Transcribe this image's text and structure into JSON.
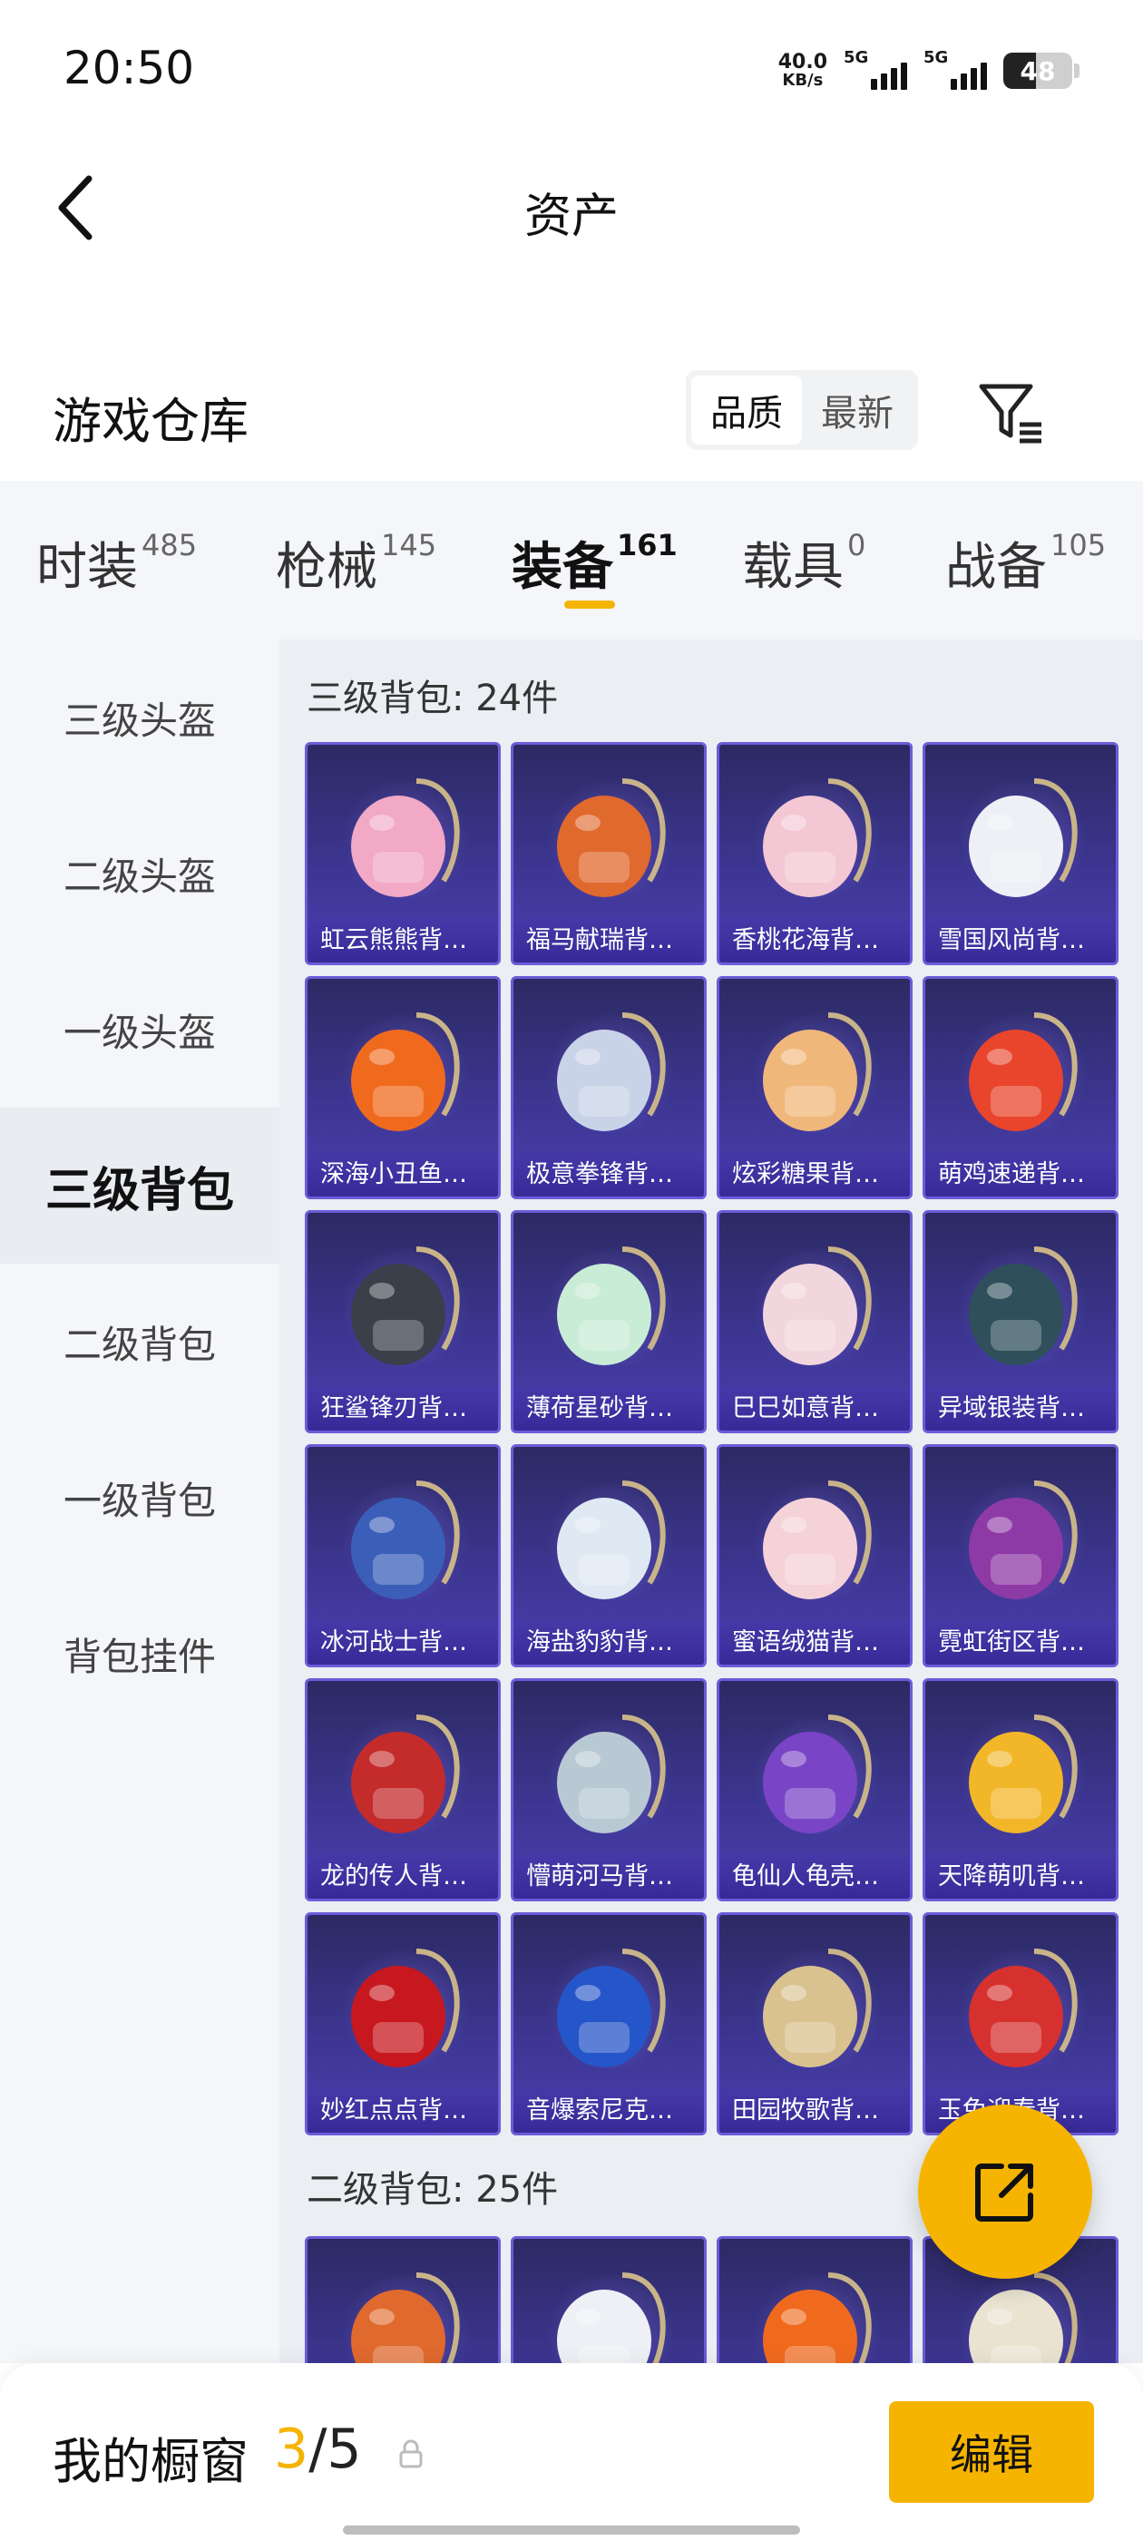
{
  "status_bar": {
    "time": "20:50",
    "net_speed_value": "40.0",
    "net_speed_unit": "KB/s",
    "sim1_tag": "5G",
    "sim2_tag": "5G",
    "battery": "48"
  },
  "header": {
    "back_icon": "chevron-left-icon",
    "title": "资产"
  },
  "section": {
    "title": "游戏仓库",
    "sort_options": [
      "品质",
      "最新"
    ],
    "active_sort": "品质",
    "filter_icon": "filter-icon"
  },
  "category_tabs": [
    {
      "label": "时装",
      "count": "485"
    },
    {
      "label": "枪械",
      "count": "145"
    },
    {
      "label": "装备",
      "count": "161",
      "active": true
    },
    {
      "label": "载具",
      "count": "0"
    },
    {
      "label": "战备",
      "count": "105"
    }
  ],
  "sidebar": [
    {
      "label": "三级头盔"
    },
    {
      "label": "二级头盔"
    },
    {
      "label": "一级头盔"
    },
    {
      "label": "三级背包",
      "active": true
    },
    {
      "label": "二级背包"
    },
    {
      "label": "一级背包"
    },
    {
      "label": "背包挂件"
    }
  ],
  "groups": [
    {
      "title": "三级背包: 24件",
      "items": [
        {
          "name": "虹云熊熊背…",
          "color": "#f1a9c6"
        },
        {
          "name": "福马献瑞背…",
          "color": "#e0692d"
        },
        {
          "name": "香桃花海背…",
          "color": "#f3c7d4"
        },
        {
          "name": "雪国风尚背…",
          "color": "#eef0f5"
        },
        {
          "name": "深海小丑鱼…",
          "color": "#f06a1e"
        },
        {
          "name": "极意拳锋背…",
          "color": "#c9d3e8"
        },
        {
          "name": "炫彩糖果背…",
          "color": "#f0b77a"
        },
        {
          "name": "萌鸡速递背…",
          "color": "#e8452c"
        },
        {
          "name": "狂鲨锋刃背…",
          "color": "#3a3f4a"
        },
        {
          "name": "薄荷星砂背…",
          "color": "#c8ecd5"
        },
        {
          "name": "巳巳如意背…",
          "color": "#f2d6de"
        },
        {
          "name": "异域银装背…",
          "color": "#2f4f5b"
        },
        {
          "name": "冰河战士背…",
          "color": "#3b5fb8"
        },
        {
          "name": "海盐豹豹背…",
          "color": "#dfe9f3"
        },
        {
          "name": "蜜语绒猫背…",
          "color": "#f4d2d8"
        },
        {
          "name": "霓虹街区背…",
          "color": "#8e3aa6"
        },
        {
          "name": "龙的传人背…",
          "color": "#c42b2b"
        },
        {
          "name": "懵萌河马背…",
          "color": "#b9c9d4"
        },
        {
          "name": "龟仙人龟壳…",
          "color": "#7a44c7"
        },
        {
          "name": "天降萌叽背…",
          "color": "#f2b728"
        },
        {
          "name": "妙红点点背…",
          "color": "#c7181f"
        },
        {
          "name": "音爆索尼克…",
          "color": "#2556c9"
        },
        {
          "name": "田园牧歌背…",
          "color": "#d9c28f"
        },
        {
          "name": "玉兔迎春背…",
          "color": "#d6312f"
        }
      ]
    },
    {
      "title": "二级背包: 25件",
      "items": [
        {
          "name": "",
          "color": "#e0692d"
        },
        {
          "name": "",
          "color": "#eef0f5"
        },
        {
          "name": "",
          "color": "#f06a1e"
        },
        {
          "name": "",
          "color": "#e9e3d0"
        }
      ]
    }
  ],
  "fab": {
    "icon": "share-icon"
  },
  "bottom_bar": {
    "label": "我的橱窗",
    "current": "3",
    "separator": "/",
    "total": "5",
    "lock_icon": "lock-icon",
    "edit_label": "编辑"
  }
}
